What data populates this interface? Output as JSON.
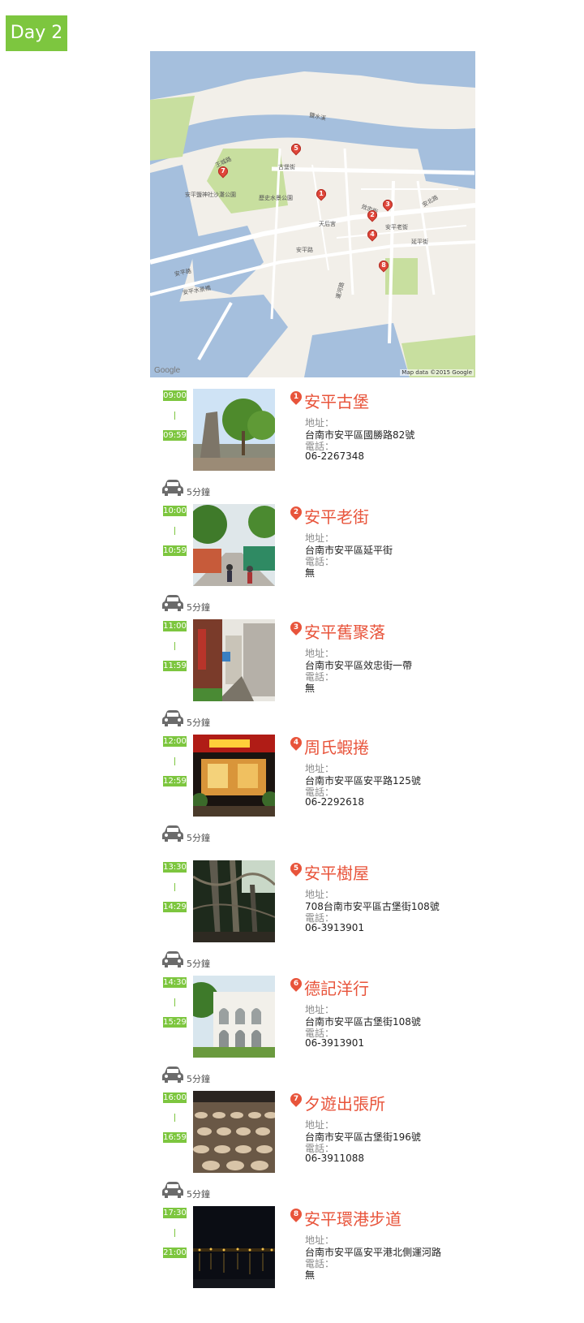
{
  "day_label": "Day 2",
  "map": {
    "labels": [
      "鹽水溪",
      "王城路",
      "安平鹽神社沙灘公園",
      "歷史水景公園",
      "古堡街",
      "安平路",
      "天后宮",
      "安平老街",
      "效忠街",
      "安北路",
      "安平水景橋",
      "安平路",
      "延平街",
      "運河路"
    ],
    "google_label": "Google",
    "credit": "Map data ©2015 Google"
  },
  "stops": [
    {
      "num": "1",
      "name": "安平古堡",
      "start": "09:00",
      "end": "09:59",
      "address_label": "地址：",
      "address": "台南市安平區國勝路82號",
      "phone_label": "電話：",
      "phone": "06-2267348"
    },
    {
      "num": "2",
      "name": "安平老街",
      "start": "10:00",
      "end": "10:59",
      "address_label": "地址：",
      "address": "台南市安平區延平街",
      "phone_label": "電話：",
      "phone": "無"
    },
    {
      "num": "3",
      "name": "安平舊聚落",
      "start": "11:00",
      "end": "11:59",
      "address_label": "地址：",
      "address": "台南市安平區效忠街一帶",
      "phone_label": "電話：",
      "phone": "無"
    },
    {
      "num": "4",
      "name": "周氏蝦捲",
      "start": "12:00",
      "end": "12:59",
      "address_label": "地址：",
      "address": "台南市安平區安平路125號",
      "phone_label": "電話：",
      "phone": "06-2292618"
    },
    {
      "num": "5",
      "name": "安平樹屋",
      "start": "13:30",
      "end": "14:29",
      "address_label": "地址：",
      "address": "708台南市安平區古堡街108號",
      "phone_label": "電話：",
      "phone": "06-3913901"
    },
    {
      "num": "6",
      "name": "德記洋行",
      "start": "14:30",
      "end": "15:29",
      "address_label": "地址：",
      "address": "台南市安平區古堡街108號",
      "phone_label": "電話：",
      "phone": "06-3913901"
    },
    {
      "num": "7",
      "name": "夕遊出張所",
      "start": "16:00",
      "end": "16:59",
      "address_label": "地址：",
      "address": "台南市安平區古堡街196號",
      "phone_label": "電話：",
      "phone": "06-3911088"
    },
    {
      "num": "8",
      "name": "安平環港步道",
      "start": "17:30",
      "end": "21:00",
      "address_label": "地址：",
      "address": "台南市安平區安平港北側運河路",
      "phone_label": "電話：",
      "phone": "無"
    }
  ],
  "travel": [
    {
      "duration": "5分鐘"
    },
    {
      "duration": "5分鐘"
    },
    {
      "duration": "5分鐘"
    },
    {
      "duration": "5分鐘"
    },
    {
      "duration": "5分鐘"
    },
    {
      "duration": "5分鐘"
    },
    {
      "duration": "5分鐘"
    }
  ],
  "colors": {
    "accent_green": "#7dc63f",
    "accent_red": "#e8543b",
    "map_water": "#a5bfdd",
    "map_park": "#c8df9f"
  }
}
